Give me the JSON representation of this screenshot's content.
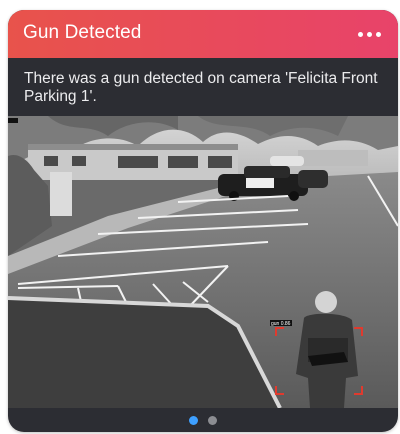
{
  "alert": {
    "title": "Gun Detected",
    "message": "There was a gun detected on camera 'Felicita Front Parking 1'."
  },
  "menu": {
    "icon": "more-horizontal-icon"
  },
  "detection": {
    "label": "gun 0.86"
  },
  "pager": {
    "count": 2,
    "active_index": 0
  },
  "colors": {
    "header_start": "#e8534b",
    "header_end": "#e8436a",
    "card_background": "#2c2d33",
    "detection_box": "#e03a2e",
    "pager_active": "#3ea0ff",
    "pager_inactive": "#8c8d92"
  }
}
